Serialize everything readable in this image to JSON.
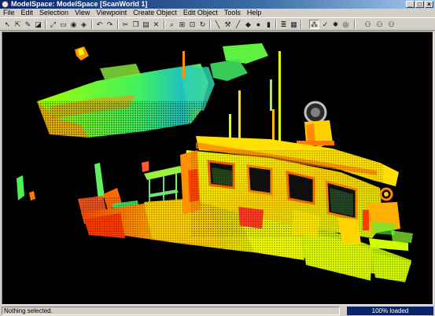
{
  "window": {
    "title": "ModelSpace: ModelSpace [ScanWorld 1]"
  },
  "menu": {
    "items": [
      "File",
      "Edit",
      "Selection",
      "View",
      "Viewpoint",
      "Create Object",
      "Edit Object",
      "Tools",
      "Help"
    ]
  },
  "toolbar": {
    "icons": [
      "select-cursor-icon",
      "pick-cursor-icon",
      "pencil-icon",
      "fence-icon",
      "fit-icon",
      "rectangle-icon",
      "camera-icon",
      "cube-icon",
      "undo-icon",
      "redo-icon",
      "cut-icon",
      "copy-icon",
      "paste-icon",
      "delete-icon",
      "zoom-icon",
      "zoom-fit-icon",
      "zoom-extents-icon",
      "orbit-icon",
      "line-tool-icon",
      "wrench-icon",
      "pipe-icon",
      "shape-icon",
      "sphere-icon",
      "cylinder-icon",
      "layers-icon",
      "color-map-icon",
      "pointcloud-active-icon",
      "brush-icon",
      "globe-icon",
      "target-icon",
      "walk-icon",
      "fly-icon",
      "seek-icon"
    ]
  },
  "colors": {
    "background": "#000000",
    "title": "#0a246a",
    "chrome": "#d4d0c8"
  },
  "status": {
    "text": "Nothing selected.",
    "progress": "100% loaded",
    "progress_value": 1.0
  }
}
